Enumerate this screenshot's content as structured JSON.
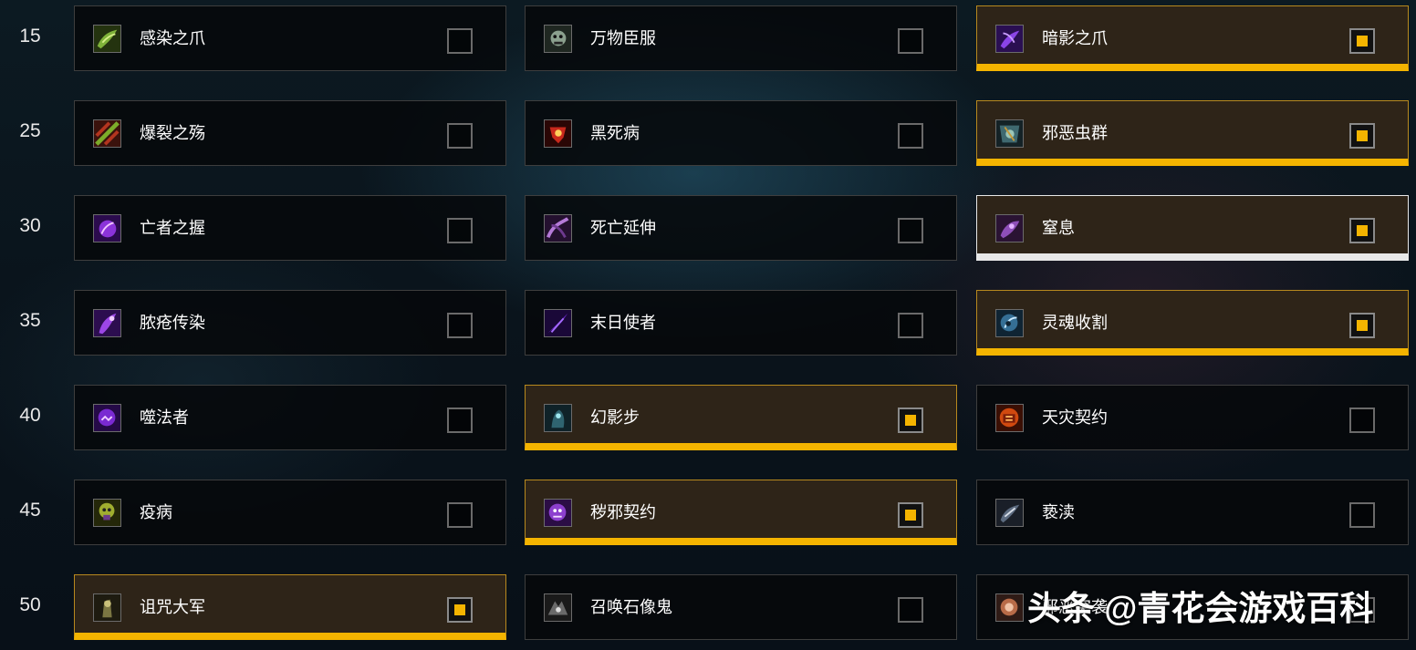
{
  "rows": [
    {
      "level": "15",
      "talents": [
        {
          "name": "感染之爪",
          "icon": "infected-claws-icon",
          "selected": false,
          "color": "#5f8f2c"
        },
        {
          "name": "万物臣服",
          "icon": "all-will-serve-icon",
          "selected": false,
          "color": "#6d7d6f"
        },
        {
          "name": "暗影之爪",
          "icon": "clawing-shadows-icon",
          "selected": true,
          "color": "#6c2bbf"
        }
      ]
    },
    {
      "level": "25",
      "talents": [
        {
          "name": "爆裂之殇",
          "icon": "bursting-sores-icon",
          "selected": false,
          "color": "#8a2a1b"
        },
        {
          "name": "黑死病",
          "icon": "ebon-fever-icon",
          "selected": false,
          "color": "#b3261e"
        },
        {
          "name": "邪恶虫群",
          "icon": "unholy-blight-icon",
          "selected": true,
          "color": "#3c5d63"
        }
      ]
    },
    {
      "level": "30",
      "talents": [
        {
          "name": "亡者之握",
          "icon": "grip-of-the-dead-icon",
          "selected": false,
          "color": "#8a2bd8"
        },
        {
          "name": "死亡延伸",
          "icon": "deaths-reach-icon",
          "selected": false,
          "color": "#7a3fa8"
        },
        {
          "name": "窒息",
          "icon": "asphyxiate-icon",
          "selected": true,
          "color": "#7b3a9e"
        }
      ]
    },
    {
      "level": "35",
      "talents": [
        {
          "name": "脓疮传染",
          "icon": "pestilent-pustules-icon",
          "selected": false,
          "color": "#8a3ccc"
        },
        {
          "name": "末日使者",
          "icon": "harbinger-of-doom-icon",
          "selected": false,
          "color": "#5a1f9a"
        },
        {
          "name": "灵魂收割",
          "icon": "soul-reaper-icon",
          "selected": true,
          "color": "#3a6f8f"
        }
      ]
    },
    {
      "level": "40",
      "talents": [
        {
          "name": "噬法者",
          "icon": "spell-eater-icon",
          "selected": false,
          "color": "#6d25b0"
        },
        {
          "name": "幻影步",
          "icon": "wraith-walk-icon",
          "selected": true,
          "color": "#2f5f6a"
        },
        {
          "name": "天灾契约",
          "icon": "death-pact-icon",
          "selected": false,
          "color": "#c2410c"
        }
      ]
    },
    {
      "level": "45",
      "talents": [
        {
          "name": "疫病",
          "icon": "pestilence-icon",
          "selected": false,
          "color": "#8f9f2a"
        },
        {
          "name": "秽邪契约",
          "icon": "defile-icon",
          "selected": true,
          "color": "#8a3cc9"
        },
        {
          "name": "亵渎",
          "icon": "desecration-icon",
          "selected": false,
          "color": "#4c5a6e"
        }
      ]
    },
    {
      "level": "50",
      "talents": [
        {
          "name": "诅咒大军",
          "icon": "army-of-the-damned-icon",
          "selected": true,
          "color": "#6e6a3a"
        },
        {
          "name": "召唤石像鬼",
          "icon": "summon-gargoyle-icon",
          "selected": false,
          "color": "#5c5c5c"
        },
        {
          "name": "邪恶突袭",
          "icon": "unholy-assault-icon",
          "selected": false,
          "color": "#b05a3a"
        }
      ]
    }
  ],
  "watermark": "头条 @青花会游戏百科",
  "colors": {
    "accent": "#f4b400",
    "selected_background": "#2e2418",
    "panel_background": "#06080a"
  }
}
